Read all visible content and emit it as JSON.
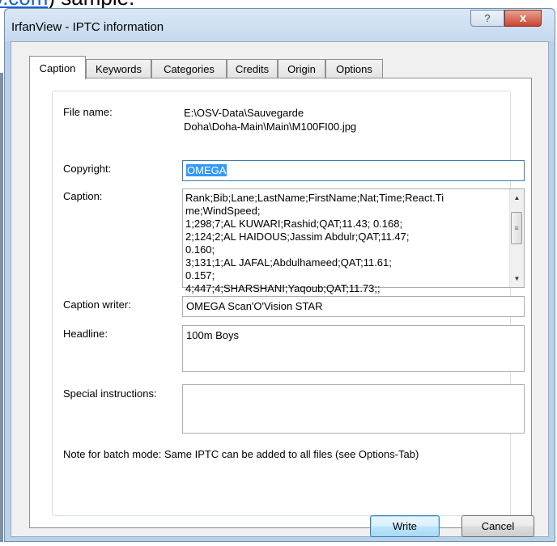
{
  "background": {
    "link_fragment": "v.com",
    "text_after": ") sample."
  },
  "window": {
    "title": "IrfanView - IPTC information",
    "help_icon": "?",
    "close_icon": "x"
  },
  "tabs": [
    {
      "label": "Caption",
      "active": true
    },
    {
      "label": "Keywords"
    },
    {
      "label": "Categories"
    },
    {
      "label": "Credits"
    },
    {
      "label": "Origin"
    },
    {
      "label": "Options"
    }
  ],
  "form": {
    "file_name_label": "File name:",
    "file_name_line1": "E:\\OSV-Data\\Sauvegarde",
    "file_name_line2": "Doha\\Doha-Main\\Main\\M100FI00.jpg",
    "copyright_label": "Copyright:",
    "copyright_value": "OMEGA",
    "caption_label": "Caption:",
    "caption_lines": [
      "Rank;Bib;Lane;LastName;FirstName;Nat;Time;React.Ti",
      "me;WindSpeed;",
      "1;298;7;AL KUWARI;Rashid;QAT;11.43; 0.168;",
      "2;124;2;AL HAIDOUS;Jassim Abdulr;QAT;11.47; 0.160;",
      "3;131;1;AL JAFAL;Abdulhameed;QAT;11.61; 0.157;",
      "4;447;4;SHARSHANI;Yaqoub;QAT;11.73;;"
    ],
    "caption_writer_label": "Caption writer:",
    "caption_writer_value": "OMEGA Scan'O'Vision STAR",
    "headline_label": "Headline:",
    "headline_value": "100m Boys",
    "special_instructions_label": "Special instructions:",
    "special_instructions_value": "",
    "note": "Note for batch mode: Same IPTC can be added to all files (see Options-Tab)"
  },
  "buttons": {
    "write": "Write",
    "cancel": "Cancel"
  }
}
